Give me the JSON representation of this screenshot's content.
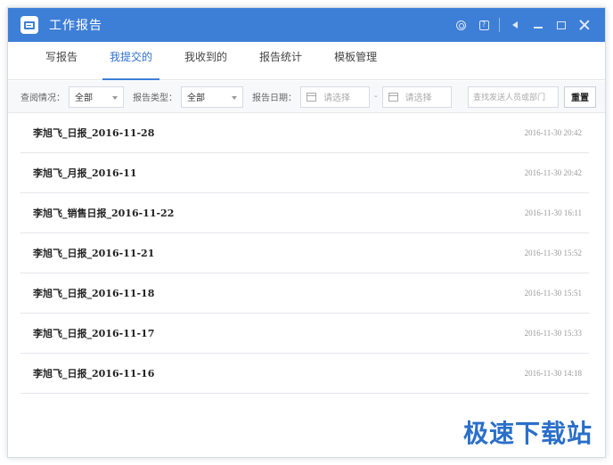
{
  "window": {
    "title": "工作报告"
  },
  "titlebar": {
    "icons": [
      "gear-icon",
      "help-icon",
      "sound-icon",
      "minimize-icon",
      "maximize-icon",
      "close-icon"
    ]
  },
  "tabs": [
    {
      "label": "写报告"
    },
    {
      "label": "我提交的"
    },
    {
      "label": "我收到的"
    },
    {
      "label": "报告统计"
    },
    {
      "label": "模板管理"
    }
  ],
  "active_tab": "我提交的",
  "filters": {
    "query_label": "查阅情况：",
    "query_value": "全部",
    "type_label": "报告类型：",
    "type_value": "全部",
    "date_label": "报告日期：",
    "date_start_placeholder": "请选择",
    "date_separator": "-",
    "date_end_placeholder": "请选择",
    "search_placeholder": "查找发送人员或部门",
    "reset_label": "重置"
  },
  "reports": [
    {
      "name": "李旭飞_日报_2016-11-28",
      "time": "2016-11-30 20:42"
    },
    {
      "name": "李旭飞_月报_2016-11",
      "time": "2016-11-30 20:42"
    },
    {
      "name": "李旭飞_销售日报_2016-11-22",
      "time": "2016-11-30 16:11"
    },
    {
      "name": "李旭飞_日报_2016-11-21",
      "time": "2016-11-30 15:52"
    },
    {
      "name": "李旭飞_日报_2016-11-18",
      "time": "2016-11-30 15:51"
    },
    {
      "name": "李旭飞_日报_2016-11-17",
      "time": "2016-11-30 15:33"
    },
    {
      "name": "李旭飞_日报_2016-11-16",
      "time": "2016-11-30 14:18"
    }
  ],
  "watermark": "极速下载站",
  "colors": {
    "accent": "#3d7fd6",
    "watermark": "#2a6fc9"
  }
}
